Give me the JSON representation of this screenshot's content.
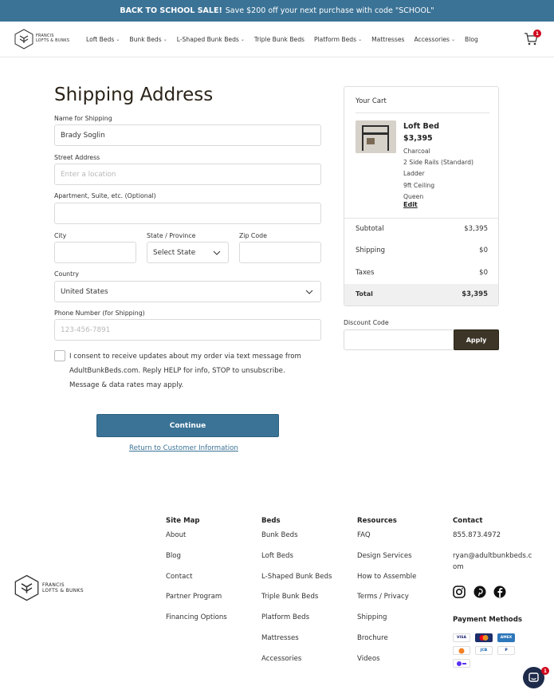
{
  "banner": {
    "bold": "BACK TO SCHOOL SALE!",
    "text": "Save $200 off your next purchase with code \"SCHOOL\""
  },
  "logo": {
    "line1": "FRANCIS",
    "line2": "LOFTS & BUNKS"
  },
  "nav": [
    {
      "label": "Loft Beds",
      "has_menu": true
    },
    {
      "label": "Bunk Beds",
      "has_menu": true
    },
    {
      "label": "L-Shaped Bunk Beds",
      "has_menu": true
    },
    {
      "label": "Triple Bunk Beds",
      "has_menu": false
    },
    {
      "label": "Platform Beds",
      "has_menu": true
    },
    {
      "label": "Mattresses",
      "has_menu": false
    },
    {
      "label": "Accessories",
      "has_menu": true
    },
    {
      "label": "Blog",
      "has_menu": false
    }
  ],
  "cart_badge": "1",
  "form": {
    "title": "Shipping Address",
    "name_label": "Name for Shipping",
    "name_value": "Brady Soglin",
    "street_label": "Street Address",
    "street_placeholder": "Enter a location",
    "apt_label": "Apartment, Suite, etc. (Optional)",
    "city_label": "City",
    "state_label": "State / Province",
    "state_value": "Select State",
    "zip_label": "Zip Code",
    "country_label": "Country",
    "country_value": "United States",
    "phone_label": "Phone Number (for Shipping)",
    "phone_placeholder": "123-456-7891",
    "consent_text": "I consent to receive updates about my order via text message from AdultBunkBeds.com. Reply HELP for info, STOP to unsubscribe. Message & data rates may apply.",
    "continue_label": "Continue",
    "return_label": "Return to Customer Information"
  },
  "cart": {
    "title": "Your Cart",
    "product_name": "Loft Bed",
    "product_price": "$3,395",
    "options": [
      "Charcoal",
      "2 Side Rails (Standard)",
      "Ladder",
      "9ft Ceiling",
      "Queen"
    ],
    "edit_label": "Edit",
    "subtotal_label": "Subtotal",
    "subtotal_value": "$3,395",
    "shipping_label": "Shipping",
    "shipping_value": "$0",
    "taxes_label": "Taxes",
    "taxes_value": "$0",
    "total_label": "Total",
    "total_value": "$3,395"
  },
  "discount": {
    "label": "Discount Code",
    "apply_label": "Apply"
  },
  "footer": {
    "sitemap": {
      "heading": "Site Map",
      "links": [
        "About",
        "Blog",
        "Contact",
        "Partner Program",
        "Financing Options"
      ]
    },
    "beds": {
      "heading": "Beds",
      "links": [
        "Bunk Beds",
        "Loft Beds",
        "L-Shaped Bunk Beds",
        "Triple Bunk Beds",
        "Platform Beds",
        "Mattresses",
        "Accessories"
      ]
    },
    "resources": {
      "heading": "Resources",
      "links": [
        "FAQ",
        "Design Services",
        "How to Assemble",
        "Terms / Privacy",
        "Shipping",
        "Brochure",
        "Videos"
      ]
    },
    "contact": {
      "heading": "Contact",
      "phone": "855.873.4972",
      "email_line1": "ryan@adultbunkbeds.c",
      "email_line2": "om",
      "payment_heading": "Payment Methods"
    },
    "payments": [
      "VISA",
      "Mastercard",
      "AMEX",
      "Discover",
      "JCB",
      "PayPal",
      "Shop Pay"
    ]
  },
  "chat_badge": "1",
  "colors": {
    "brand_blue": "#3b7396",
    "dark_button": "#3d3527"
  }
}
